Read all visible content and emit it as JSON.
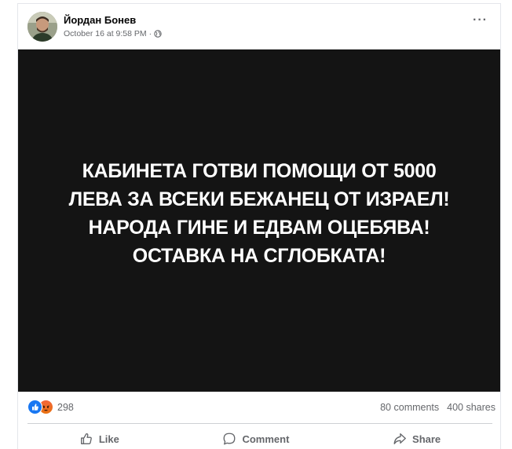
{
  "post": {
    "author": "Йордан Бонев",
    "timestamp": "October 16 at 9:58 PM",
    "separator": "·",
    "privacy_icon": "globe-icon",
    "more_icon": "more-options-icon",
    "more_label": "···",
    "image_text": "КАБИНЕТА ГОТВИ ПОМОЩИ ОТ 5000\nЛЕВА ЗА ВСЕКИ БЕЖАНЕЦ ОТ ИЗРАЕЛ!\nНАРОДА ГИНЕ И ЕДВАМ ОЦЕБЯВА!\nОСТАВКА НА СГЛОБКАТА!",
    "image_background": "#141414"
  },
  "stats": {
    "reaction_icons": [
      "like-reaction-icon",
      "angry-reaction-icon"
    ],
    "reaction_count": "298",
    "comments": "80 comments",
    "shares": "400 shares"
  },
  "actions": {
    "like_label": "Like",
    "comment_label": "Comment",
    "share_label": "Share"
  },
  "colors": {
    "accent": "#1877f2",
    "muted_text": "#65676b",
    "angry": "#f0632f"
  }
}
